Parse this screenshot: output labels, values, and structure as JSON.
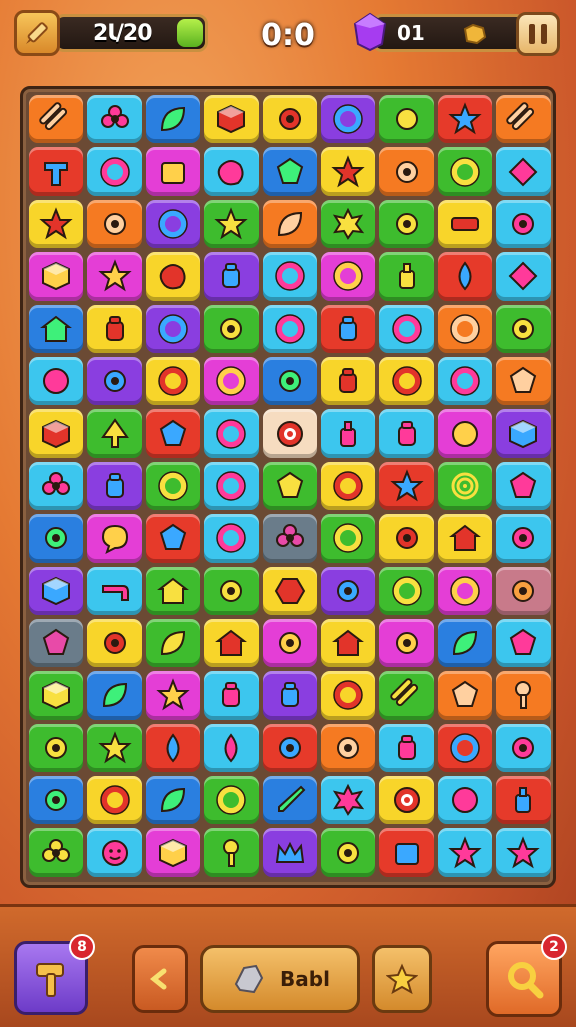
{
  "hud": {
    "score_left": "2Ɩ/20",
    "center_score": "0:0",
    "gem_count": "01",
    "colors": {
      "accent": "#c99040",
      "gem": "#a63cf0",
      "cap": "#7bd02c"
    }
  },
  "board": {
    "cols": 9,
    "rows": 15,
    "tiles": [
      [
        "orange:stripes",
        "cyan:flower",
        "blue:leaf",
        "yellow:cube",
        "yellow:gear",
        "purple:ring",
        "green:bell",
        "red:star",
        "orange:stripes"
      ],
      [
        "red:tshape",
        "cyan:ring",
        "magenta:box",
        "cyan:blob",
        "blue:gem",
        "yellow:star",
        "orange:gear",
        "green:ring",
        "cyan:diamond"
      ],
      [
        "yellow:star",
        "orange:gear",
        "purple:ring",
        "green:star",
        "orange:leaf",
        "green:splat",
        "green:gear",
        "yellow:bar",
        "cyan:gear"
      ],
      [
        "magenta:cube",
        "magenta:star",
        "yellow:blob",
        "purple:jar",
        "cyan:ring",
        "magenta:ring",
        "green:bottle",
        "red:drop",
        "cyan:diamond"
      ],
      [
        "blue:house",
        "yellow:jar",
        "purple:ring",
        "green:gear",
        "cyan:ring",
        "red:jar",
        "cyan:ring",
        "orange:ring",
        "green:gear"
      ],
      [
        "cyan:dot",
        "purple:gear",
        "yellow:ring",
        "magenta:ring",
        "blue:gear",
        "yellow:jar",
        "yellow:ring",
        "cyan:ring",
        "orange:gem"
      ],
      [
        "yellow:cube",
        "green:tree",
        "red:gem",
        "cyan:ring",
        "cream:target",
        "cyan:bottle",
        "cyan:jar",
        "magenta:dot",
        "purple:cube"
      ],
      [
        "cyan:flower",
        "purple:jar",
        "green:ring",
        "cyan:ring",
        "green:gem",
        "yellow:ring",
        "red:star",
        "green:spiral",
        "cyan:gem"
      ],
      [
        "blue:gear",
        "magenta:bubble",
        "red:gem",
        "cyan:ring",
        "gray:flower",
        "green:ring",
        "yellow:gear",
        "yellow:house",
        "cyan:gear"
      ],
      [
        "purple:cube",
        "cyan:pipe",
        "green:house",
        "green:gear",
        "yellow:hex",
        "purple:gear",
        "green:ring",
        "magenta:ring",
        "rose:gear"
      ],
      [
        "gray:gem",
        "yellow:gear",
        "green:leaf",
        "yellow:house",
        "magenta:gear",
        "yellow:house",
        "magenta:gear",
        "blue:leaf",
        "cyan:gem"
      ],
      [
        "green:cube",
        "blue:leaf",
        "magenta:star",
        "cyan:jar",
        "purple:jar",
        "yellow:ring",
        "green:stripes",
        "orange:gem",
        "orange:key"
      ],
      [
        "green:gear",
        "green:star",
        "red:drop",
        "cyan:drop",
        "red:gear",
        "orange:gear",
        "cyan:jar",
        "red:ring",
        "cyan:gear"
      ],
      [
        "blue:gear",
        "yellow:ring",
        "blue:leaf",
        "green:ring",
        "blue:sword",
        "cyan:splat",
        "yellow:target",
        "cyan:dot",
        "red:bottle"
      ],
      [
        "green:flower",
        "cyan:face",
        "magenta:cube",
        "green:key",
        "purple:crown",
        "green:gear",
        "red:box",
        "cyan:star",
        "cyan:star"
      ]
    ]
  },
  "bottom_bar": {
    "hammer_count": "8",
    "main_label": "Babl",
    "search_count": "2"
  }
}
